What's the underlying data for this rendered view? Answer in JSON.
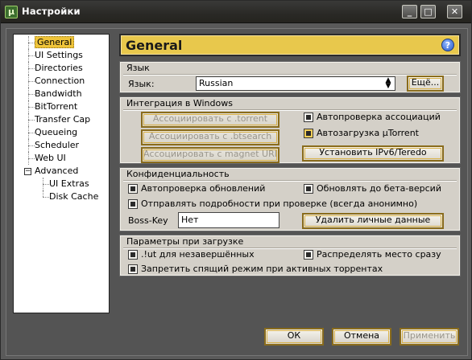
{
  "window": {
    "title": "Настройки"
  },
  "tree": {
    "items": [
      {
        "label": "General",
        "selected": true
      },
      {
        "label": "UI Settings"
      },
      {
        "label": "Directories"
      },
      {
        "label": "Connection"
      },
      {
        "label": "Bandwidth"
      },
      {
        "label": "BitTorrent"
      },
      {
        "label": "Transfer Cap"
      },
      {
        "label": "Queueing"
      },
      {
        "label": "Scheduler"
      },
      {
        "label": "Web UI"
      },
      {
        "label": "Advanced",
        "expander": "−"
      },
      {
        "label": "UI Extras"
      },
      {
        "label": "Disk Cache"
      }
    ]
  },
  "header": {
    "title": "General"
  },
  "language": {
    "group_title": "Язык",
    "label": "Язык:",
    "value": "Russian",
    "more_button": "Ещё..."
  },
  "integration": {
    "group_title": "Интеграция в Windows",
    "assoc_torrent": "Ассоциировать с .torrent",
    "assoc_btsearch": "Ассоциировать с .btsearch",
    "assoc_magnet": "Ассоциировать с magnet URI",
    "check_assoc": "Автопроверка ассоциаций",
    "autostart": "Автозагрузка µTorrent",
    "install_ipv6": "Установить IPv6/Teredo"
  },
  "privacy": {
    "group_title": "Конфиденциальность",
    "auto_update": "Автопроверка обновлений",
    "beta_update": "Обновлять до бета-версий",
    "send_details": "Отправлять подробности при проверке (всегда анонимно)",
    "boss_key_label": "Boss-Key",
    "boss_key_value": "Нет",
    "delete_private": "Удалить личные данные"
  },
  "startup": {
    "group_title": "Параметры при загрузке",
    "ut_incomplete": ".!ut для незавершённых",
    "preallocate": "Распределять место сразу",
    "prevent_sleep": "Запретить спящий режим при активных торрентах"
  },
  "footer": {
    "ok": "ОК",
    "cancel": "Отмена",
    "apply": "Применить"
  },
  "colors": {
    "accent": "#e8c84c",
    "selection": "#f0c53a"
  }
}
